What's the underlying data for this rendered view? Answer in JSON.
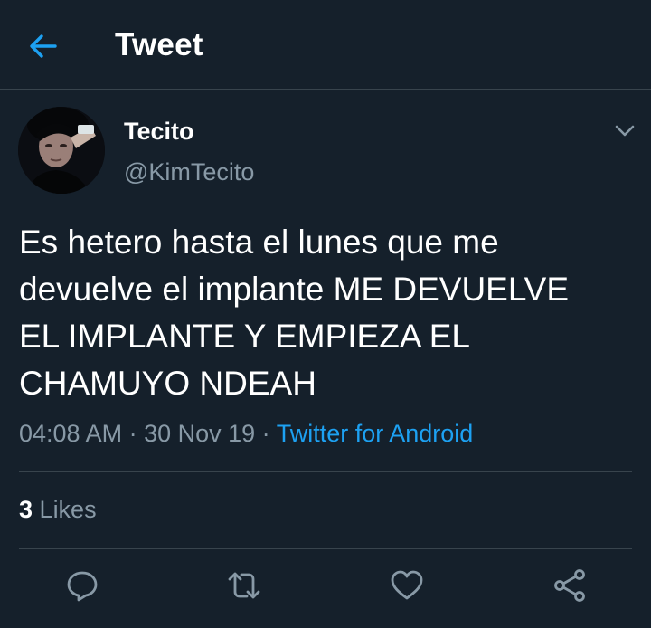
{
  "header": {
    "title": "Tweet",
    "back_icon": "arrow-left-icon"
  },
  "author": {
    "display_name": "Tecito",
    "handle": "@KimTecito"
  },
  "tweet": {
    "text": "Es hetero hasta el lunes que me\ndevuelve el implante ME DEVUELVE\nEL IMPLANTE Y EMPIEZA EL\nCHAMUYO NDEAH",
    "time": "04:08 AM",
    "separator": " · ",
    "date": "30 Nov 19",
    "source_separator": " · ",
    "source": "Twitter for Android"
  },
  "stats": {
    "likes_count": "3",
    "likes_label": "Likes"
  },
  "actions": {
    "reply_icon": "reply-icon",
    "retweet_icon": "retweet-icon",
    "like_icon": "heart-icon",
    "share_icon": "share-icon"
  },
  "colors": {
    "background": "#15202b",
    "accent": "#1da1f2",
    "secondary_text": "#8899a6",
    "divider": "#38444d"
  }
}
